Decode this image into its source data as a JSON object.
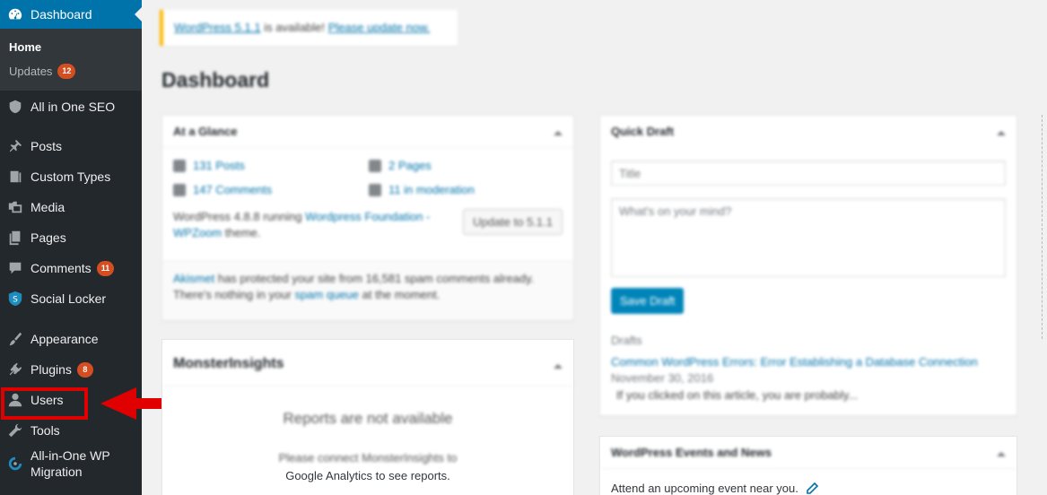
{
  "sidebar": {
    "dashboard": {
      "label": "Dashboard",
      "icon": "dashboard-icon"
    },
    "submenu": [
      {
        "label": "Home",
        "current": true
      },
      {
        "label": "Updates",
        "badge": "12"
      }
    ],
    "items": [
      {
        "label": "All in One SEO",
        "icon": "shield-icon"
      },
      {
        "label": "Posts",
        "icon": "pushpin-icon"
      },
      {
        "label": "Custom Types",
        "icon": "archive-icon"
      },
      {
        "label": "Media",
        "icon": "media-icon"
      },
      {
        "label": "Pages",
        "icon": "pages-icon"
      },
      {
        "label": "Comments",
        "icon": "comment-icon",
        "badge": "11"
      },
      {
        "label": "Social Locker",
        "icon": "social-locker-icon"
      },
      {
        "label": "Appearance",
        "icon": "paintbrush-icon"
      },
      {
        "label": "Plugins",
        "icon": "plugin-icon",
        "badge": "8"
      },
      {
        "label": "Users",
        "icon": "user-icon"
      },
      {
        "label": "Tools",
        "icon": "wrench-icon"
      },
      {
        "label": "All-in-One WP Migration",
        "icon": "migration-icon"
      }
    ]
  },
  "annotation": {
    "highlight_color": "#e00000"
  },
  "notice": {
    "link1": "WordPress 5.1.1",
    "text": " is available! ",
    "link2": "Please update now."
  },
  "page": {
    "title": "Dashboard"
  },
  "glance": {
    "title": "At a Glance",
    "posts": "131 Posts",
    "pages": "2 Pages",
    "comments": "147 Comments",
    "moderation": "11 in moderation",
    "running_prefix": "WordPress 4.8.8 running ",
    "theme_link": "Wordpress Foundation - WPZoom",
    "running_suffix": " theme.",
    "update_button": "Update to 5.1.1",
    "akismet_link": "Akismet",
    "akismet_text": " has protected your site from 16,581 spam comments already.",
    "spam_prefix": "There's nothing in your ",
    "spam_link": "spam queue",
    "spam_suffix": " at the moment."
  },
  "monster": {
    "title": "MonsterInsights",
    "unavailable": "Reports are not available",
    "connect_line1": "Please connect MonsterInsights to",
    "connect_line2": "Google Analytics to see reports."
  },
  "quickdraft": {
    "title": "Quick Draft",
    "title_placeholder": "Title",
    "content_placeholder": "What's on your mind?",
    "save_button": "Save Draft",
    "drafts_label": "Drafts",
    "draft_link": "Common WordPress Errors: Error Establishing a Database Connection",
    "draft_date": " November 30, 2016",
    "draft_excerpt": "If you clicked on this article, you are probably..."
  },
  "events": {
    "title": "WordPress Events and News",
    "attend_text": "Attend an upcoming event near you."
  },
  "colors": {
    "sidebar_bg": "#23282d",
    "active_bg": "#0073aa",
    "badge_bg": "#d54e21",
    "link": "#0073aa"
  }
}
